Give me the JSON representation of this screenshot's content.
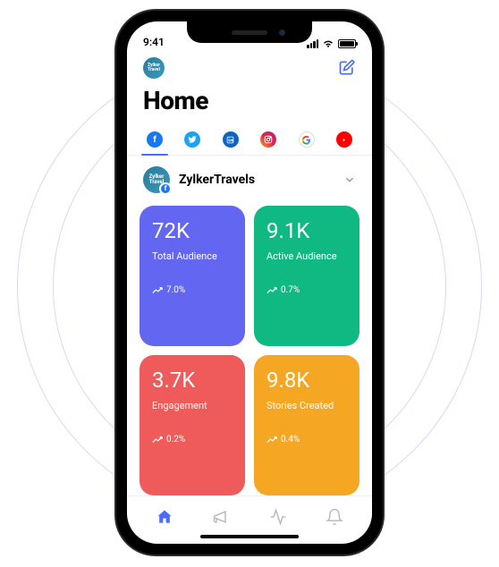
{
  "status_bar": {
    "time": "9:41"
  },
  "header": {
    "avatar_label": "Zylker Travel",
    "page_title": "Home"
  },
  "tabs": {
    "active_index": 0,
    "items": [
      {
        "name": "facebook"
      },
      {
        "name": "twitter"
      },
      {
        "name": "linkedin"
      },
      {
        "name": "instagram"
      },
      {
        "name": "google"
      },
      {
        "name": "youtube"
      }
    ]
  },
  "account": {
    "name": "ZylkerTravels",
    "avatar_label": "Zylker Travel",
    "badge": "f"
  },
  "cards": [
    {
      "value": "72K",
      "label": "Total Audience",
      "trend": "7.0%",
      "color": "c1"
    },
    {
      "value": "9.1K",
      "label": "Active Audience",
      "trend": "0.7%",
      "color": "c2"
    },
    {
      "value": "3.7K",
      "label": "Engagement",
      "trend": "0.2%",
      "color": "c3"
    },
    {
      "value": "9.8K",
      "label": "Stories Created",
      "trend": "0.4%",
      "color": "c4"
    }
  ],
  "bottom_nav": {
    "active_index": 0,
    "items": [
      "home",
      "announce",
      "activity",
      "notifications"
    ]
  }
}
